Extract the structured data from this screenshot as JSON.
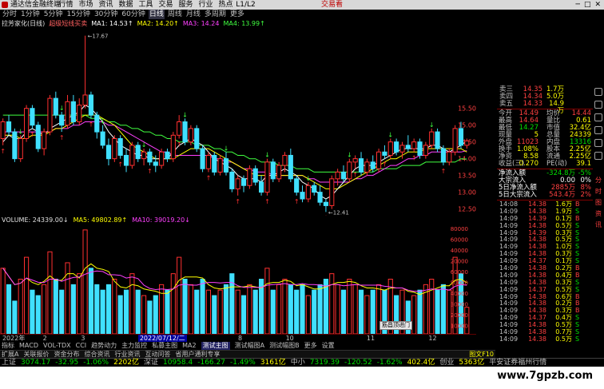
{
  "titlebar": {
    "app_title": "通达信金融终端",
    "menus": [
      "行情",
      "市场",
      "资讯",
      "数据",
      "工具",
      "交易",
      "服务",
      "行业",
      "热点",
      "L1/L2"
    ],
    "brand": "交易看",
    "controls": [
      "─",
      "□",
      "✕"
    ]
  },
  "toolbar": {
    "periods": [
      "分时",
      "1分钟",
      "5分钟",
      "15分钟",
      "30分钟",
      "60分钟",
      "日线",
      "周线",
      "月线",
      "多周期",
      "更多"
    ],
    "active_period": "日线"
  },
  "ma_legend": {
    "stock_name": "拉芳家化(日线)",
    "indicator": "超级短线买卖",
    "ma1": "MA1: 14.53↑",
    "ma2": "MA2: 14.20↑",
    "ma3": "MA3: 14.24",
    "ma4": "MA4: 13.99↑"
  },
  "vol_legend": {
    "vol": "VOLUME: 24339.00↓",
    "ma5": "MA5: 49802.89↑",
    "ma10": "MA10: 39019.20↓"
  },
  "chart_data": {
    "type": "candlestick",
    "price_axis": [
      "15.50",
      "15.00",
      "14.50",
      "14.00",
      "13.50",
      "13.00",
      "12.50"
    ],
    "vol_axis": [
      "80000",
      "60000",
      "40000",
      "20000",
      "60000",
      "50000",
      "40000",
      "30000",
      "20000",
      "10000"
    ],
    "high_label": "17.67",
    "low_label": "12.41",
    "ylim": [
      12.3,
      17.9
    ],
    "candles": [
      [
        14.6,
        15.2,
        14.4,
        15.1
      ],
      [
        15.1,
        15.3,
        14.7,
        14.8
      ],
      [
        14.8,
        14.9,
        13.9,
        14.0
      ],
      [
        14.0,
        14.7,
        13.9,
        14.6
      ],
      [
        14.6,
        15.6,
        14.5,
        15.5
      ],
      [
        15.5,
        15.6,
        14.9,
        15.0
      ],
      [
        15.0,
        15.1,
        14.2,
        14.3
      ],
      [
        14.3,
        14.9,
        14.1,
        14.8
      ],
      [
        14.8,
        15.9,
        14.7,
        15.8
      ],
      [
        15.8,
        16.0,
        15.2,
        15.3
      ],
      [
        15.3,
        15.4,
        14.8,
        15.0
      ],
      [
        15.0,
        15.9,
        14.9,
        15.7
      ],
      [
        15.7,
        15.9,
        15.0,
        15.1
      ],
      [
        15.1,
        15.8,
        15.0,
        15.6
      ],
      [
        15.6,
        17.67,
        15.5,
        15.9
      ],
      [
        15.9,
        16.0,
        15.2,
        15.3
      ],
      [
        15.3,
        15.4,
        14.6,
        14.8
      ],
      [
        14.8,
        15.0,
        14.3,
        14.4
      ],
      [
        14.4,
        14.6,
        13.8,
        14.0
      ],
      [
        14.0,
        14.7,
        13.9,
        14.6
      ],
      [
        14.6,
        14.7,
        14.0,
        14.1
      ],
      [
        14.1,
        14.3,
        13.6,
        13.8
      ],
      [
        13.8,
        14.5,
        13.7,
        14.4
      ],
      [
        14.4,
        14.5,
        13.9,
        14.0
      ],
      [
        14.0,
        14.3,
        13.8,
        14.2
      ],
      [
        14.2,
        14.3,
        13.8,
        13.9
      ],
      [
        13.9,
        14.1,
        13.6,
        13.8
      ],
      [
        13.8,
        14.3,
        13.7,
        14.2
      ],
      [
        14.2,
        14.3,
        13.9,
        14.0
      ],
      [
        14.0,
        14.8,
        13.9,
        14.7
      ],
      [
        14.7,
        15.3,
        14.6,
        15.1
      ],
      [
        15.1,
        15.2,
        14.4,
        14.5
      ],
      [
        14.5,
        15.0,
        14.4,
        14.9
      ],
      [
        14.9,
        15.0,
        14.2,
        14.3
      ],
      [
        14.3,
        14.4,
        13.6,
        13.7
      ],
      [
        13.7,
        14.2,
        13.6,
        14.1
      ],
      [
        14.1,
        14.2,
        13.5,
        13.6
      ],
      [
        13.6,
        14.1,
        13.5,
        14.0
      ],
      [
        14.0,
        14.2,
        13.5,
        13.6
      ],
      [
        13.6,
        13.7,
        13.0,
        13.1
      ],
      [
        13.1,
        13.5,
        12.9,
        13.4
      ],
      [
        13.4,
        13.5,
        13.0,
        13.2
      ],
      [
        13.2,
        13.8,
        13.1,
        13.7
      ],
      [
        13.7,
        13.8,
        13.2,
        13.3
      ],
      [
        13.3,
        13.5,
        12.9,
        13.0
      ],
      [
        13.0,
        14.0,
        12.9,
        13.9
      ],
      [
        13.9,
        14.0,
        13.3,
        13.4
      ],
      [
        13.4,
        13.9,
        13.3,
        13.8
      ],
      [
        13.8,
        14.2,
        13.6,
        14.1
      ],
      [
        14.1,
        14.3,
        13.3,
        13.4
      ],
      [
        13.4,
        13.5,
        12.9,
        13.0
      ],
      [
        13.0,
        13.2,
        12.7,
        12.8
      ],
      [
        12.8,
        13.3,
        12.7,
        13.2
      ],
      [
        13.2,
        13.3,
        12.9,
        13.0
      ],
      [
        13.0,
        13.2,
        12.6,
        12.7
      ],
      [
        12.7,
        12.8,
        12.41,
        12.6
      ],
      [
        12.6,
        13.5,
        12.5,
        13.4
      ],
      [
        13.4,
        13.7,
        13.2,
        13.6
      ],
      [
        13.6,
        13.8,
        13.3,
        13.4
      ],
      [
        13.4,
        14.0,
        13.3,
        13.9
      ],
      [
        13.9,
        14.1,
        13.7,
        14.0
      ],
      [
        14.0,
        14.2,
        13.5,
        13.6
      ],
      [
        13.6,
        14.0,
        13.5,
        13.9
      ],
      [
        13.9,
        14.1,
        13.6,
        13.7
      ],
      [
        13.7,
        14.3,
        13.6,
        14.2
      ],
      [
        14.2,
        14.4,
        14.0,
        14.1
      ],
      [
        14.1,
        14.6,
        14.0,
        14.5
      ],
      [
        14.5,
        14.6,
        14.1,
        14.2
      ],
      [
        14.2,
        14.5,
        14.0,
        14.4
      ],
      [
        14.4,
        14.7,
        14.2,
        14.3
      ],
      [
        14.3,
        14.6,
        14.2,
        14.5
      ],
      [
        14.5,
        14.6,
        14.0,
        14.1
      ],
      [
        14.1,
        14.5,
        14.0,
        14.4
      ],
      [
        14.4,
        14.9,
        14.3,
        14.8
      ],
      [
        14.8,
        14.9,
        14.2,
        14.3
      ],
      [
        14.3,
        14.4,
        13.8,
        13.9
      ],
      [
        13.9,
        14.3,
        13.8,
        14.2
      ],
      [
        14.2,
        15.0,
        14.1,
        14.9
      ],
      [
        14.9,
        15.1,
        14.3,
        14.4
      ],
      [
        14.4,
        14.6,
        14.3,
        14.53
      ]
    ],
    "volumes": [
      60,
      45,
      30,
      50,
      70,
      40,
      35,
      45,
      75,
      50,
      40,
      65,
      45,
      55,
      95,
      60,
      45,
      40,
      45,
      50,
      35,
      40,
      55,
      40,
      35,
      30,
      35,
      45,
      40,
      55,
      70,
      50,
      45,
      40,
      50,
      40,
      35,
      40,
      45,
      55,
      40,
      35,
      45,
      40,
      50,
      60,
      40,
      45,
      50,
      45,
      40,
      45,
      35,
      40,
      45,
      50,
      55,
      45,
      40,
      50,
      45,
      40,
      35,
      40,
      45,
      40,
      50,
      35,
      40,
      30,
      35,
      40,
      45,
      50,
      40,
      45,
      40,
      70,
      55,
      24.3
    ],
    "ma1": [
      14.5,
      14.7,
      14.6,
      14.6,
      14.8,
      14.9,
      14.8,
      14.7,
      14.9,
      15.0,
      15.1,
      15.2,
      15.3,
      15.4,
      15.6,
      15.5,
      15.3,
      15.1,
      14.8,
      14.6,
      14.4,
      14.3,
      14.2,
      14.1,
      14.1,
      14.0,
      14.0,
      14.0,
      14.0,
      14.2,
      14.4,
      14.5,
      14.6,
      14.5,
      14.4,
      14.2,
      14.0,
      13.9,
      13.8,
      13.7,
      13.5,
      13.4,
      13.4,
      13.4,
      13.3,
      13.5,
      13.5,
      13.6,
      13.7,
      13.6,
      13.5,
      13.3,
      13.2,
      13.1,
      12.9,
      12.8,
      12.9,
      13.1,
      13.3,
      13.5,
      13.7,
      13.8,
      13.8,
      13.8,
      13.9,
      14.0,
      14.1,
      14.2,
      14.3,
      14.3,
      14.3,
      14.3,
      14.3,
      14.4,
      14.4,
      14.3,
      14.2,
      14.3,
      14.4,
      14.53
    ],
    "ma2": [
      14.7,
      14.7,
      14.7,
      14.6,
      14.6,
      14.7,
      14.7,
      14.7,
      14.8,
      14.9,
      14.9,
      15.0,
      15.1,
      15.2,
      15.3,
      15.3,
      15.3,
      15.2,
      15.1,
      15.0,
      14.8,
      14.6,
      14.4,
      14.3,
      14.2,
      14.1,
      14.0,
      14.0,
      14.0,
      14.0,
      14.1,
      14.2,
      14.3,
      14.3,
      14.3,
      14.3,
      14.2,
      14.1,
      14.0,
      13.9,
      13.8,
      13.7,
      13.6,
      13.5,
      13.5,
      13.5,
      13.5,
      13.5,
      13.5,
      13.5,
      13.5,
      13.5,
      13.4,
      13.3,
      13.2,
      13.1,
      13.1,
      13.1,
      13.2,
      13.3,
      13.4,
      13.5,
      13.6,
      13.7,
      13.8,
      13.9,
      14.0,
      14.0,
      14.1,
      14.2,
      14.2,
      14.2,
      14.3,
      14.3,
      14.3,
      14.3,
      14.3,
      14.3,
      14.3,
      14.2
    ],
    "ma3": [
      14.8,
      14.8,
      14.8,
      14.8,
      14.8,
      14.8,
      14.8,
      14.8,
      14.8,
      14.9,
      14.9,
      14.9,
      15.0,
      15.0,
      15.1,
      15.1,
      15.1,
      15.1,
      15.0,
      15.0,
      14.9,
      14.8,
      14.7,
      14.6,
      14.5,
      14.4,
      14.3,
      14.2,
      14.2,
      14.1,
      14.1,
      14.1,
      14.1,
      14.1,
      14.1,
      14.1,
      14.0,
      14.0,
      13.9,
      13.9,
      13.8,
      13.7,
      13.7,
      13.6,
      13.6,
      13.6,
      13.5,
      13.5,
      13.5,
      13.5,
      13.5,
      13.5,
      13.4,
      13.4,
      13.3,
      13.3,
      13.3,
      13.3,
      13.3,
      13.3,
      13.4,
      13.4,
      13.5,
      13.5,
      13.6,
      13.7,
      13.8,
      13.8,
      13.9,
      14.0,
      14.0,
      14.1,
      14.1,
      14.2,
      14.2,
      14.2,
      14.2,
      14.2,
      14.2,
      14.24
    ],
    "ma4": [
      15.3,
      15.3,
      15.3,
      15.3,
      15.3,
      15.3,
      15.3,
      15.3,
      15.3,
      15.3,
      15.3,
      15.3,
      15.3,
      15.3,
      15.3,
      15.2,
      15.2,
      15.2,
      15.1,
      15.1,
      15.0,
      15.0,
      14.9,
      14.9,
      14.8,
      14.8,
      14.7,
      14.7,
      14.6,
      14.6,
      14.5,
      14.5,
      14.5,
      14.4,
      14.4,
      14.4,
      14.3,
      14.3,
      14.2,
      14.2,
      14.1,
      14.1,
      14.0,
      14.0,
      13.9,
      13.9,
      13.9,
      13.8,
      13.8,
      13.8,
      13.7,
      13.7,
      13.7,
      13.6,
      13.6,
      13.6,
      13.6,
      13.6,
      13.6,
      13.6,
      13.6,
      13.6,
      13.6,
      13.6,
      13.7,
      13.7,
      13.7,
      13.7,
      13.8,
      13.8,
      13.8,
      13.8,
      13.9,
      13.9,
      13.9,
      13.9,
      13.9,
      13.9,
      14.0,
      13.99
    ]
  },
  "date_axis": [
    {
      "label": "2022年",
      "pos": 0.005
    },
    {
      "label": "2",
      "pos": 0.09
    },
    {
      "label": "3",
      "pos": 0.17
    },
    {
      "label": "2022/07/12/二",
      "pos": 0.29,
      "selected": true
    },
    {
      "label": "8",
      "pos": 0.5
    },
    {
      "label": "10",
      "pos": 0.6
    },
    {
      "label": "11",
      "pos": 0.77
    },
    {
      "label": "12",
      "pos": 0.9
    }
  ],
  "bottom_tabs": [
    "指标",
    "MACD",
    "VOL-TDX",
    "CCI",
    "趋势动力",
    "主力监控",
    "私募主图",
    "MA2",
    "测试主图",
    "测试幅图A",
    "测试幅图B",
    "更多",
    "设置"
  ],
  "bottom_tabs_active": "测试主图",
  "bottom_tabs2": [
    "扩展A",
    "关联报价",
    "资金分布",
    "综合资讯",
    "行业资讯",
    "互动问答",
    "省用户通利专享"
  ],
  "bottom_tabs2_right": "图文F10",
  "quote": {
    "asks": [
      {
        "label": "卖三",
        "price": "14.35",
        "vol": "1.7万"
      },
      {
        "label": "卖四",
        "price": "14.34",
        "vol": "5.0万"
      },
      {
        "label": "卖五",
        "price": "14.33",
        "vol": "14.9万"
      }
    ],
    "stats": [
      {
        "l1": "今开",
        "v1": "14.49",
        "c1": "red",
        "l2": "均价",
        "v2": "14.44",
        "c2": "red"
      },
      {
        "l1": "最高",
        "v1": "14.64",
        "c1": "red",
        "l2": "量比",
        "v2": "0.61",
        "c2": "yellow"
      },
      {
        "l1": "最低",
        "v1": "14.27",
        "c1": "green",
        "l2": "市值",
        "v2": "32.4亿",
        "c2": "yellow"
      },
      {
        "l1": "现量",
        "v1": "5",
        "c1": "yellow",
        "l2": "总量",
        "v2": "24339",
        "c2": "yellow"
      },
      {
        "l1": "外盘",
        "v1": "11023",
        "c1": "red",
        "l2": "内盘",
        "v2": "13316",
        "c2": "green"
      },
      {
        "l1": "换手",
        "v1": "1.08%",
        "c1": "yellow",
        "l2": "股本",
        "v2": "2.25亿",
        "c2": "yellow"
      },
      {
        "l1": "净资",
        "v1": "8.58",
        "c1": "yellow",
        "l2": "流通",
        "v2": "2.25亿",
        "c2": "yellow"
      },
      {
        "l1": "收益(三)",
        "v1": "0.270",
        "c1": "yellow",
        "l2": "PE(动)",
        "v2": "39.1",
        "c2": "yellow"
      }
    ],
    "flows": [
      {
        "label": "净流入额",
        "value": "-324.8万",
        "pct": "-5%",
        "color": "green"
      },
      {
        "label": "大宗流入",
        "value": "0.00",
        "pct": "0%",
        "color": "white"
      },
      {
        "label": "5日净流入额",
        "value": "2885万",
        "pct": "8%",
        "color": "red"
      },
      {
        "label": "5日大宗流入",
        "value": "543.4万",
        "pct": "2%",
        "color": "red"
      }
    ],
    "ticks": [
      {
        "t": "14:08",
        "p": "14.38",
        "v": "1.6万",
        "d": "B"
      },
      {
        "t": "14:09",
        "p": "14.38",
        "v": "1.9万",
        "d": "S"
      },
      {
        "t": "14:09",
        "p": "14.39",
        "v": "0.1万",
        "d": "B"
      },
      {
        "t": "14:09",
        "p": "14.38",
        "v": "0.5万",
        "d": "S"
      },
      {
        "t": "14:09",
        "p": "14.39",
        "v": "0.3万",
        "d": "S"
      },
      {
        "t": "14:09",
        "p": "14.38",
        "v": "0.5万",
        "d": "S"
      },
      {
        "t": "14:09",
        "p": "14.38",
        "v": "1.0万",
        "d": "S"
      },
      {
        "t": "14:09",
        "p": "14.38",
        "v": "0.3万",
        "d": "S"
      },
      {
        "t": "14:09",
        "p": "14.37",
        "v": "0.1万",
        "d": "S"
      },
      {
        "t": "14:09",
        "p": "14.38",
        "v": "0.2万",
        "d": "B"
      },
      {
        "t": "14:09",
        "p": "14.38",
        "v": "0.4万",
        "d": "B"
      },
      {
        "t": "14:09",
        "p": "14.38",
        "v": "0.3万",
        "d": "S"
      },
      {
        "t": "14:09",
        "p": "14.37",
        "v": "0.5万",
        "d": "S"
      },
      {
        "t": "14:09",
        "p": "14.38",
        "v": "0.6万",
        "d": "B"
      },
      {
        "t": "14:09",
        "p": "14.38",
        "v": "0.2万",
        "d": "B"
      },
      {
        "t": "14:09",
        "p": "14.38",
        "v": "0.3万",
        "d": "B"
      },
      {
        "t": "14:09",
        "p": "14.37",
        "v": "0.4万",
        "d": "S"
      },
      {
        "t": "14:09",
        "p": "14.38",
        "v": "0.5万",
        "d": "S"
      },
      {
        "t": "14:09",
        "p": "14.38",
        "v": "0.7万",
        "d": "S"
      },
      {
        "t": "14:09",
        "p": "14.38",
        "v": "0.5万",
        "d": "S"
      }
    ]
  },
  "vtool_labels": [
    "分",
    "时",
    "图",
    "资",
    "讯"
  ],
  "status": {
    "items": [
      {
        "name": "上证",
        "val": "3074.17",
        "chg": "-32.95",
        "pct": "-1.06%",
        "amt": "2202亿"
      },
      {
        "name": "深证",
        "val": "10958.4",
        "chg": "-166.27",
        "pct": "-1.49%",
        "amt": "3161亿"
      },
      {
        "name": "中小",
        "val": "7319.39",
        "chg": "-120.52",
        "pct": "-1.62%",
        "amt": "402.4亿"
      },
      {
        "name": "创业",
        "val": "",
        "chg": "",
        "pct": "",
        "amt": "5363亿"
      }
    ],
    "broker": "平安证券福州行情"
  },
  "tooltip": "筋昌顶进门",
  "watermark": "www.7gpzb.com"
}
